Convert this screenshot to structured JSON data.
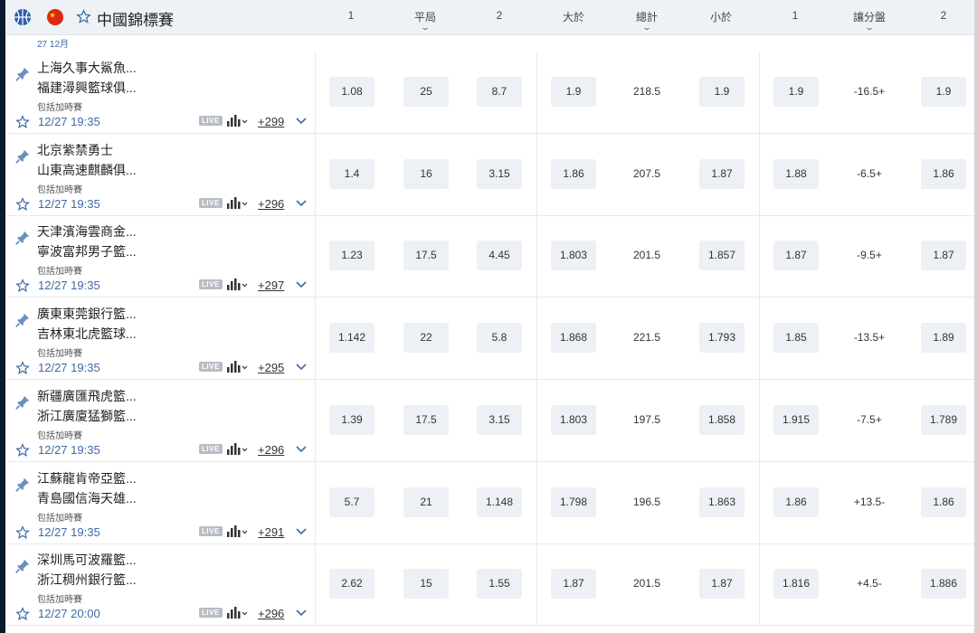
{
  "header": {
    "league": "中國錦標賽",
    "columns": [
      "1",
      "平局",
      "2",
      "大於",
      "總計",
      "小於",
      "1",
      "讓分盤",
      "2"
    ],
    "date": "27 12月"
  },
  "row_labels": {
    "overtime": "包括加時賽",
    "live": "LIVE"
  },
  "matches": [
    {
      "home": "上海久事大鯊魚...",
      "away": "福建潯興籃球俱...",
      "time": "12/27 19:35",
      "more": "+299",
      "odds": [
        "1.08",
        "25",
        "8.7",
        "1.9",
        "218.5",
        "1.9",
        "1.9",
        "-16.5+",
        "1.9"
      ]
    },
    {
      "home": "北京紫禁勇士",
      "away": "山東高速麒麟俱...",
      "time": "12/27 19:35",
      "more": "+296",
      "odds": [
        "1.4",
        "16",
        "3.15",
        "1.86",
        "207.5",
        "1.87",
        "1.88",
        "-6.5+",
        "1.86"
      ]
    },
    {
      "home": "天津濱海雲商金...",
      "away": "寧波富邦男子籃...",
      "time": "12/27 19:35",
      "more": "+297",
      "odds": [
        "1.23",
        "17.5",
        "4.45",
        "1.803",
        "201.5",
        "1.857",
        "1.87",
        "-9.5+",
        "1.87"
      ]
    },
    {
      "home": "廣東東莞銀行籃...",
      "away": "吉林東北虎籃球...",
      "time": "12/27 19:35",
      "more": "+295",
      "odds": [
        "1.142",
        "22",
        "5.8",
        "1.868",
        "221.5",
        "1.793",
        "1.85",
        "-13.5+",
        "1.89"
      ]
    },
    {
      "home": "新疆廣匯飛虎籃...",
      "away": "浙江廣廈猛獅籃...",
      "time": "12/27 19:35",
      "more": "+296",
      "odds": [
        "1.39",
        "17.5",
        "3.15",
        "1.803",
        "197.5",
        "1.858",
        "1.915",
        "-7.5+",
        "1.789"
      ]
    },
    {
      "home": "江蘇龍肯帝亞籃...",
      "away": "青島國信海天雄...",
      "time": "12/27 19:35",
      "more": "+291",
      "odds": [
        "5.7",
        "21",
        "1.148",
        "1.798",
        "196.5",
        "1.863",
        "1.86",
        "+13.5-",
        "1.86"
      ]
    },
    {
      "home": "深圳馬可波羅籃...",
      "away": "浙江稠州銀行籃...",
      "time": "12/27 20:00",
      "more": "+296",
      "odds": [
        "2.62",
        "15",
        "1.55",
        "1.87",
        "201.5",
        "1.87",
        "1.816",
        "+4.5-",
        "1.886"
      ]
    }
  ]
}
